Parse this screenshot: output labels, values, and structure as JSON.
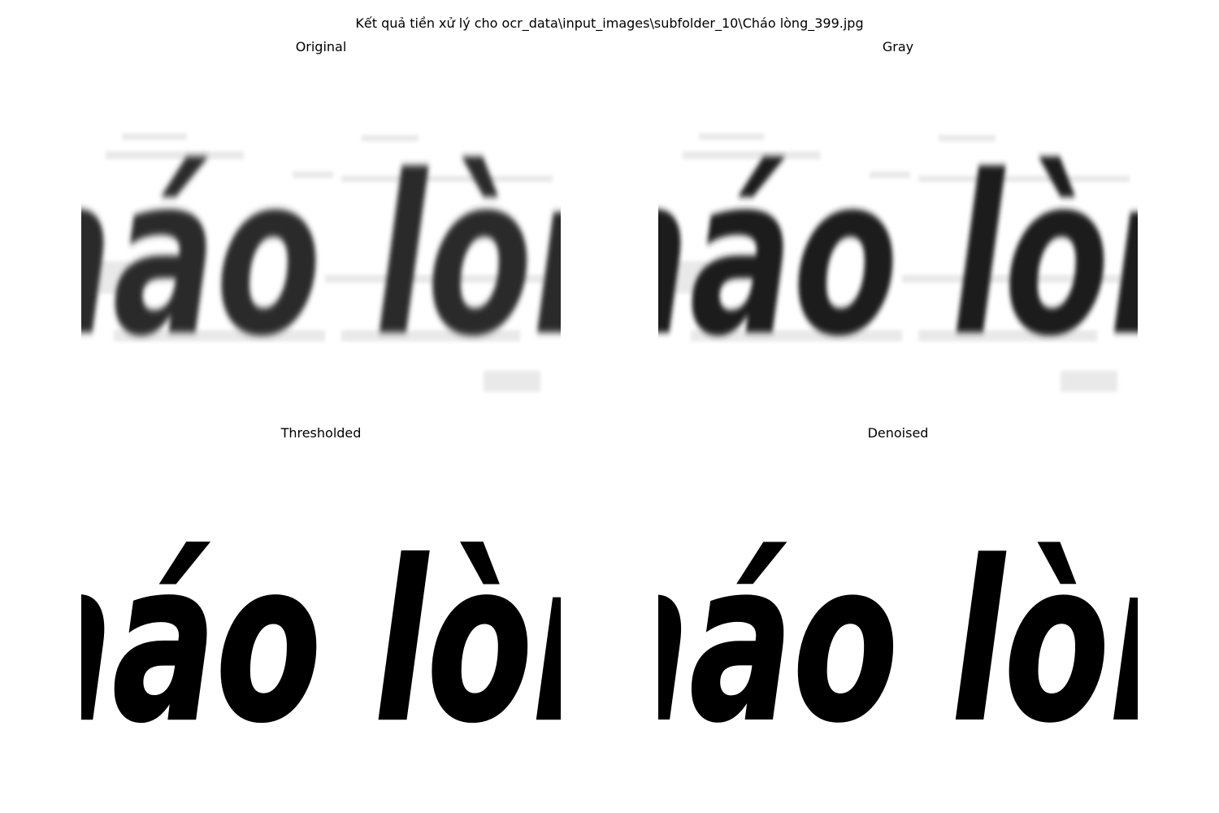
{
  "figure": {
    "suptitle": "Kết quả tiền xử lý cho ocr_data\\input_images\\subfolder_10\\Cháo lòng_399.jpg"
  },
  "panels": [
    {
      "title": "Original",
      "image_text": "Cháo lòng"
    },
    {
      "title": "Gray",
      "image_text": "Cháo lòng"
    },
    {
      "title": "Thresholded",
      "image_text": "Cháo lòng"
    },
    {
      "title": "Denoised",
      "image_text": "Cháo lòng"
    }
  ],
  "colors": {
    "original_ink": "#2b2b2b",
    "gray_ink": "#1e1e1e",
    "binary_ink": "#000000",
    "background": "#ffffff"
  }
}
